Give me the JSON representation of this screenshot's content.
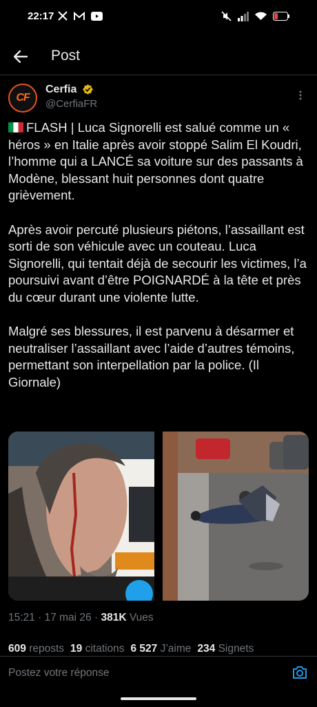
{
  "status_bar": {
    "time": "22:17",
    "icons_left": [
      "x-app-icon",
      "gmail-icon",
      "youtube-icon"
    ],
    "icons_right": [
      "mute-icon",
      "signal-icon",
      "wifi-icon",
      "battery-low-icon"
    ],
    "battery_color": "#e5484d"
  },
  "header": {
    "title": "Post"
  },
  "author": {
    "name": "Cerfia",
    "handle": "@CerfiaFR",
    "avatar_initials": "CF",
    "verified": true,
    "brand_color": "#ff6a1c"
  },
  "tweet": {
    "paragraphs": [
      "FLASH | Luca Signorelli est salué comme un « héros » en Italie après avoir stoppé Salim El Koudri, l’homme qui a LANCÉ sa voiture sur des passants à Modène, blessant huit personnes dont quatre grièvement.",
      "Après avoir percuté plusieurs piétons, l’assaillant est sorti de son véhicule avec un couteau. Luca Signorelli, qui tentait déjà de secourir les victimes, l’a poursuivi avant d’être POIGNARDÉ à la tête et près du cœur durant une violente lutte.",
      "Malgré ses blessures, il est parvenu à désarmer et neutraliser l’assaillant avec l’aide d’autres témoins, permettant son interpellation par la police. (Il Giornale)"
    ],
    "flag": "italy-flag"
  },
  "media": [
    {
      "name": "photo-injured-man"
    },
    {
      "name": "photo-street-struggle"
    }
  ],
  "meta": {
    "time": "15:21",
    "separator": "·",
    "date": "17 mai 26",
    "views_count": "381K",
    "views_label": "Vues"
  },
  "stats": {
    "reposts_count": "609",
    "reposts_label": "reposts",
    "quotes_count": "19",
    "quotes_label": "citations",
    "likes_count": "6 527",
    "likes_label": "J’aime",
    "bookmarks_count": "234",
    "bookmarks_label": "Signets"
  },
  "reply": {
    "placeholder": "Postez votre réponse",
    "accent": "#1d9bf0"
  }
}
